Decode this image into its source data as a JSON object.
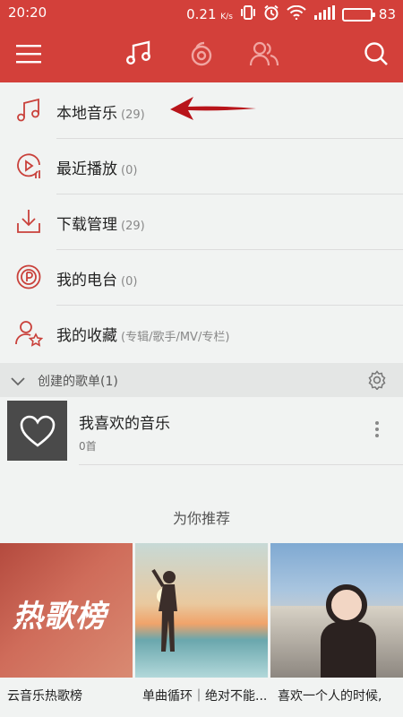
{
  "status_bar": {
    "time": "20:20",
    "speed": "0.21",
    "speed_unit": "K/s",
    "battery": "83"
  },
  "top_nav": {
    "icons": [
      "menu-icon",
      "music-note-icon",
      "netease-radio-icon",
      "friends-icon",
      "search-icon"
    ],
    "active": "music-note-icon",
    "color_bg": "#d3403a"
  },
  "menu": [
    {
      "label": "本地音乐",
      "count": "(29)",
      "icon": "music-note-icon"
    },
    {
      "label": "最近播放",
      "count": "(0)",
      "icon": "recent-play-icon"
    },
    {
      "label": "下载管理",
      "count": "(29)",
      "icon": "download-icon"
    },
    {
      "label": "我的电台",
      "count": "(0)",
      "icon": "radio-icon"
    },
    {
      "label": "我的收藏",
      "count": "(专辑/歌手/MV/专栏)",
      "icon": "favorite-user-icon"
    }
  ],
  "created_playlists": {
    "title": "创建的歌单(1)",
    "items": [
      {
        "name": "我喜欢的音乐",
        "sub": "0首"
      }
    ]
  },
  "recommend": {
    "title": "为你推荐",
    "cards": [
      {
        "caption": "云音乐热歌榜",
        "overlay": "热歌榜"
      },
      {
        "caption": "单曲循环｜绝对不能..."
      },
      {
        "caption": "喜欢一个人的时候,"
      }
    ]
  }
}
